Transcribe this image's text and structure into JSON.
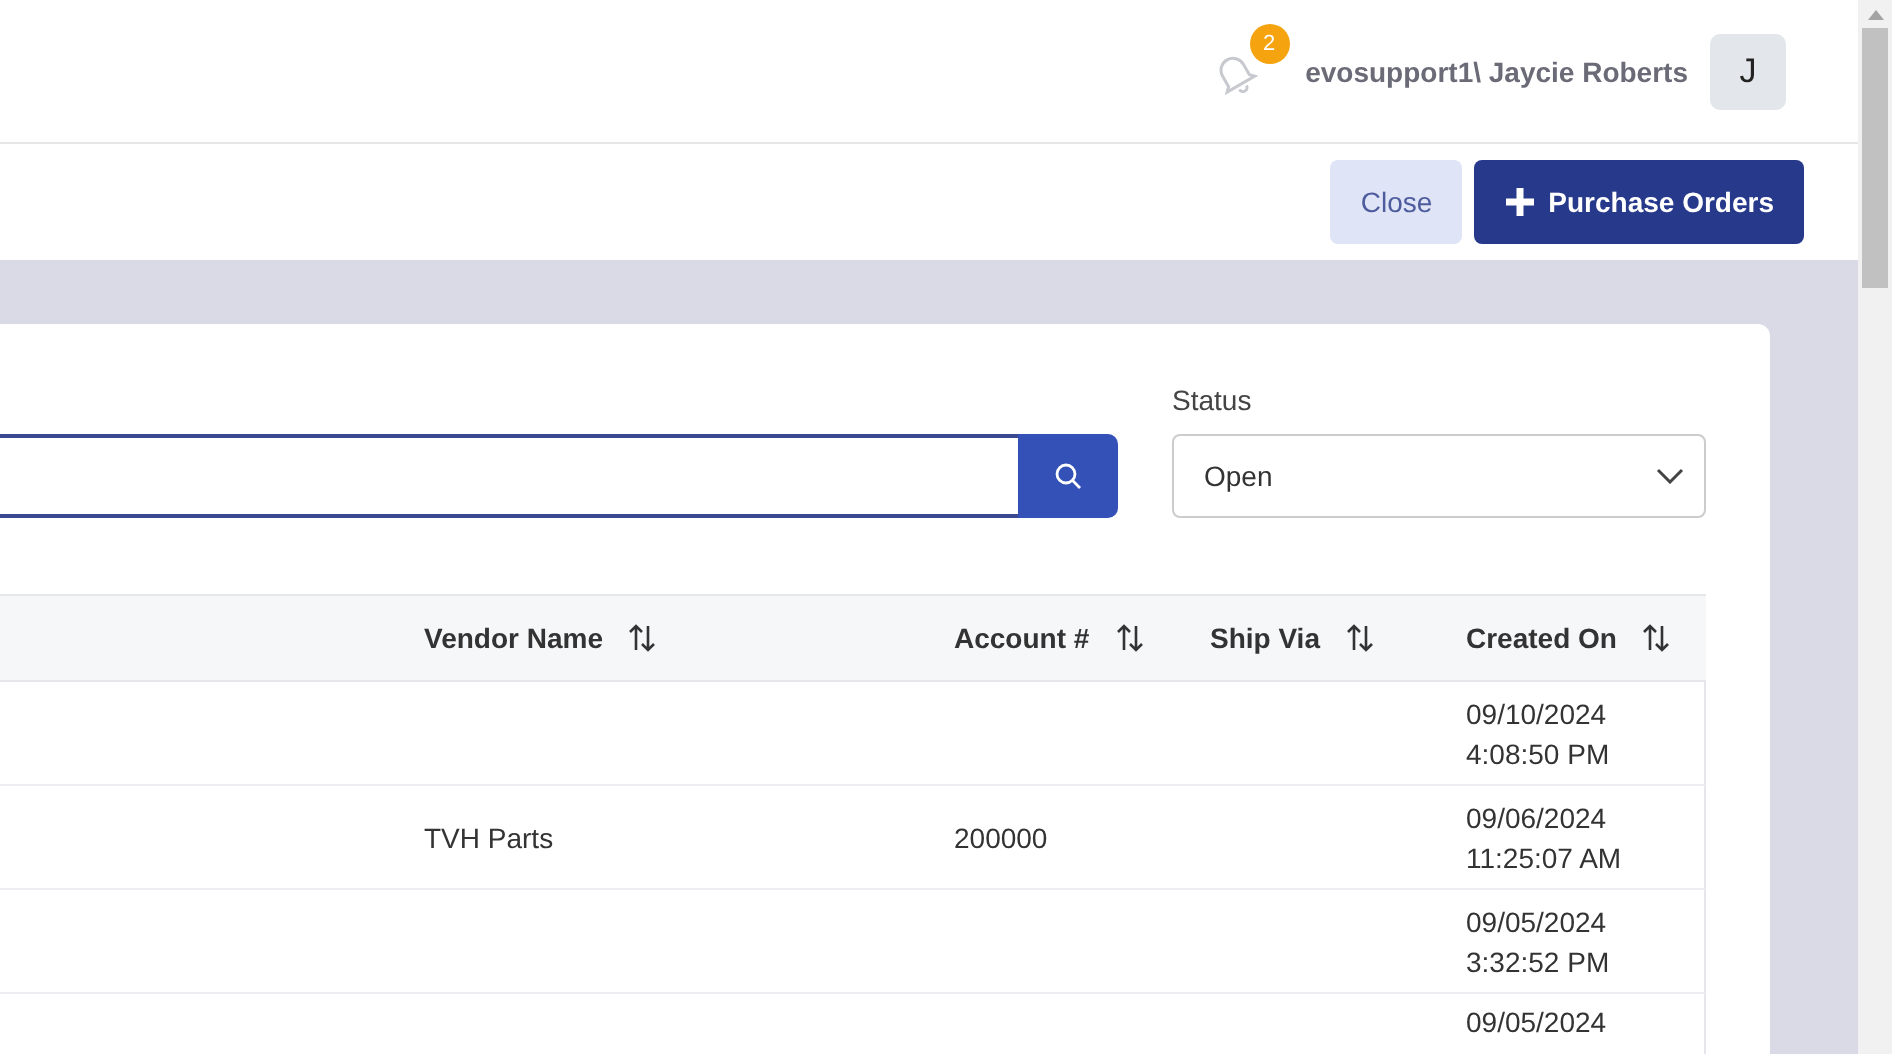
{
  "header": {
    "notifications": "2",
    "user": "evosupport1\\ Jaycie Roberts",
    "avatar": "J"
  },
  "toolbar": {
    "buttons": [
      {
        "kind": "secondary",
        "label": "Close"
      },
      {
        "kind": "primary",
        "label": "Purchase Orders"
      }
    ]
  },
  "filters": {
    "status": {
      "label": "Status",
      "value": "Open"
    }
  },
  "table": {
    "columns": [
      {
        "label": "Vendor Name"
      },
      {
        "label": "Account #"
      },
      {
        "label": "Ship Via"
      },
      {
        "label": "Created On"
      }
    ],
    "rows": [
      {
        "created_on": "09/10/2024 4:08:50 PM"
      },
      {
        "vendor_name": "TVH Parts",
        "account": "200000",
        "created_on": "09/06/2024 11:25:07 AM"
      },
      {
        "created_on": "09/05/2024 3:32:52 PM"
      },
      {
        "created_on": "09/05/2024"
      }
    ]
  }
}
